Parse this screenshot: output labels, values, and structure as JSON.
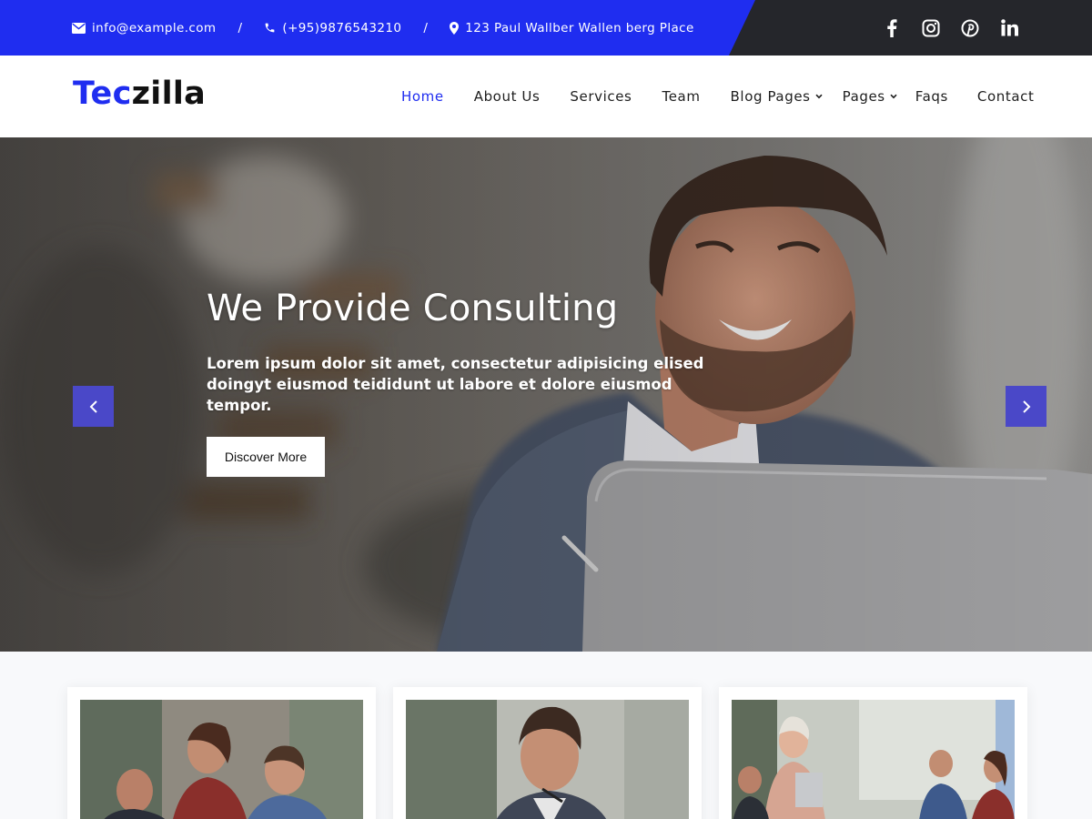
{
  "topbar": {
    "email": "info@example.com",
    "phone": "(+95)9876543210",
    "address": "123 Paul Wallber Wallen berg Place",
    "separator": "/",
    "social": [
      "facebook-icon",
      "instagram-icon",
      "pinterest-icon",
      "linkedin-icon"
    ],
    "colors": {
      "accent": "#1f2df0",
      "dark": "#25262b"
    }
  },
  "header": {
    "logo_part1": "Tec",
    "logo_part2": "zilla",
    "nav": [
      {
        "label": "Home",
        "active": true
      },
      {
        "label": "About Us"
      },
      {
        "label": "Services"
      },
      {
        "label": "Team"
      },
      {
        "label": "Blog Pages",
        "dropdown": true
      },
      {
        "label": "Pages",
        "dropdown": true
      },
      {
        "label": "Faqs"
      },
      {
        "label": "Contact"
      }
    ]
  },
  "hero": {
    "title": "We Provide Consulting",
    "text": "Lorem ipsum dolor sit amet, consectetur adipisicing elised doingyt eiusmod teididunt ut labore et dolore eiusmod tempor.",
    "button": "Discover More",
    "prev_icon": "chevron-left-icon",
    "next_icon": "chevron-right-icon",
    "arrow_color": "#4a48c8"
  },
  "cards": [
    {
      "image": "team-meeting-photo"
    },
    {
      "image": "thinking-businessman-photo"
    },
    {
      "image": "office-presentation-photo"
    }
  ]
}
